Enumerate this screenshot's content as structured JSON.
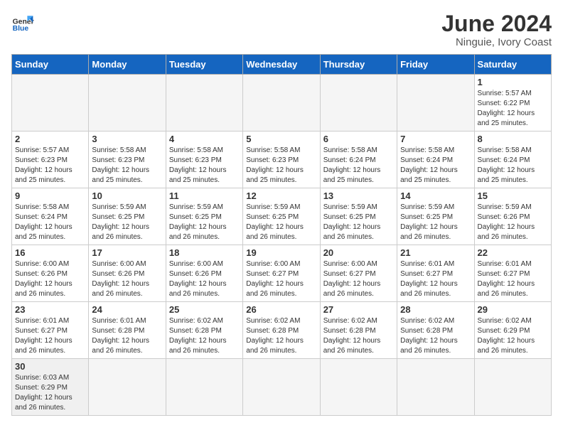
{
  "header": {
    "logo_text_regular": "General",
    "logo_text_blue": "Blue",
    "month_year": "June 2024",
    "location": "Ninguie, Ivory Coast"
  },
  "weekdays": [
    "Sunday",
    "Monday",
    "Tuesday",
    "Wednesday",
    "Thursday",
    "Friday",
    "Saturday"
  ],
  "days": [
    {
      "date": "",
      "info": ""
    },
    {
      "date": "",
      "info": ""
    },
    {
      "date": "",
      "info": ""
    },
    {
      "date": "",
      "info": ""
    },
    {
      "date": "",
      "info": ""
    },
    {
      "date": "",
      "info": ""
    },
    {
      "date": "1",
      "sunrise": "5:57 AM",
      "sunset": "6:22 PM",
      "daylight": "12 hours and 25 minutes."
    },
    {
      "date": "2",
      "sunrise": "5:57 AM",
      "sunset": "6:23 PM",
      "daylight": "12 hours and 25 minutes."
    },
    {
      "date": "3",
      "sunrise": "5:58 AM",
      "sunset": "6:23 PM",
      "daylight": "12 hours and 25 minutes."
    },
    {
      "date": "4",
      "sunrise": "5:58 AM",
      "sunset": "6:23 PM",
      "daylight": "12 hours and 25 minutes."
    },
    {
      "date": "5",
      "sunrise": "5:58 AM",
      "sunset": "6:23 PM",
      "daylight": "12 hours and 25 minutes."
    },
    {
      "date": "6",
      "sunrise": "5:58 AM",
      "sunset": "6:24 PM",
      "daylight": "12 hours and 25 minutes."
    },
    {
      "date": "7",
      "sunrise": "5:58 AM",
      "sunset": "6:24 PM",
      "daylight": "12 hours and 25 minutes."
    },
    {
      "date": "8",
      "sunrise": "5:58 AM",
      "sunset": "6:24 PM",
      "daylight": "12 hours and 25 minutes."
    },
    {
      "date": "9",
      "sunrise": "5:58 AM",
      "sunset": "6:24 PM",
      "daylight": "12 hours and 25 minutes."
    },
    {
      "date": "10",
      "sunrise": "5:59 AM",
      "sunset": "6:25 PM",
      "daylight": "12 hours and 26 minutes."
    },
    {
      "date": "11",
      "sunrise": "5:59 AM",
      "sunset": "6:25 PM",
      "daylight": "12 hours and 26 minutes."
    },
    {
      "date": "12",
      "sunrise": "5:59 AM",
      "sunset": "6:25 PM",
      "daylight": "12 hours and 26 minutes."
    },
    {
      "date": "13",
      "sunrise": "5:59 AM",
      "sunset": "6:25 PM",
      "daylight": "12 hours and 26 minutes."
    },
    {
      "date": "14",
      "sunrise": "5:59 AM",
      "sunset": "6:25 PM",
      "daylight": "12 hours and 26 minutes."
    },
    {
      "date": "15",
      "sunrise": "5:59 AM",
      "sunset": "6:26 PM",
      "daylight": "12 hours and 26 minutes."
    },
    {
      "date": "16",
      "sunrise": "6:00 AM",
      "sunset": "6:26 PM",
      "daylight": "12 hours and 26 minutes."
    },
    {
      "date": "17",
      "sunrise": "6:00 AM",
      "sunset": "6:26 PM",
      "daylight": "12 hours and 26 minutes."
    },
    {
      "date": "18",
      "sunrise": "6:00 AM",
      "sunset": "6:26 PM",
      "daylight": "12 hours and 26 minutes."
    },
    {
      "date": "19",
      "sunrise": "6:00 AM",
      "sunset": "6:27 PM",
      "daylight": "12 hours and 26 minutes."
    },
    {
      "date": "20",
      "sunrise": "6:00 AM",
      "sunset": "6:27 PM",
      "daylight": "12 hours and 26 minutes."
    },
    {
      "date": "21",
      "sunrise": "6:01 AM",
      "sunset": "6:27 PM",
      "daylight": "12 hours and 26 minutes."
    },
    {
      "date": "22",
      "sunrise": "6:01 AM",
      "sunset": "6:27 PM",
      "daylight": "12 hours and 26 minutes."
    },
    {
      "date": "23",
      "sunrise": "6:01 AM",
      "sunset": "6:27 PM",
      "daylight": "12 hours and 26 minutes."
    },
    {
      "date": "24",
      "sunrise": "6:01 AM",
      "sunset": "6:28 PM",
      "daylight": "12 hours and 26 minutes."
    },
    {
      "date": "25",
      "sunrise": "6:02 AM",
      "sunset": "6:28 PM",
      "daylight": "12 hours and 26 minutes."
    },
    {
      "date": "26",
      "sunrise": "6:02 AM",
      "sunset": "6:28 PM",
      "daylight": "12 hours and 26 minutes."
    },
    {
      "date": "27",
      "sunrise": "6:02 AM",
      "sunset": "6:28 PM",
      "daylight": "12 hours and 26 minutes."
    },
    {
      "date": "28",
      "sunrise": "6:02 AM",
      "sunset": "6:28 PM",
      "daylight": "12 hours and 26 minutes."
    },
    {
      "date": "29",
      "sunrise": "6:02 AM",
      "sunset": "6:29 PM",
      "daylight": "12 hours and 26 minutes."
    },
    {
      "date": "30",
      "sunrise": "6:03 AM",
      "sunset": "6:29 PM",
      "daylight": "12 hours and 26 minutes."
    }
  ],
  "labels": {
    "sunrise": "Sunrise:",
    "sunset": "Sunset:",
    "daylight": "Daylight:"
  }
}
